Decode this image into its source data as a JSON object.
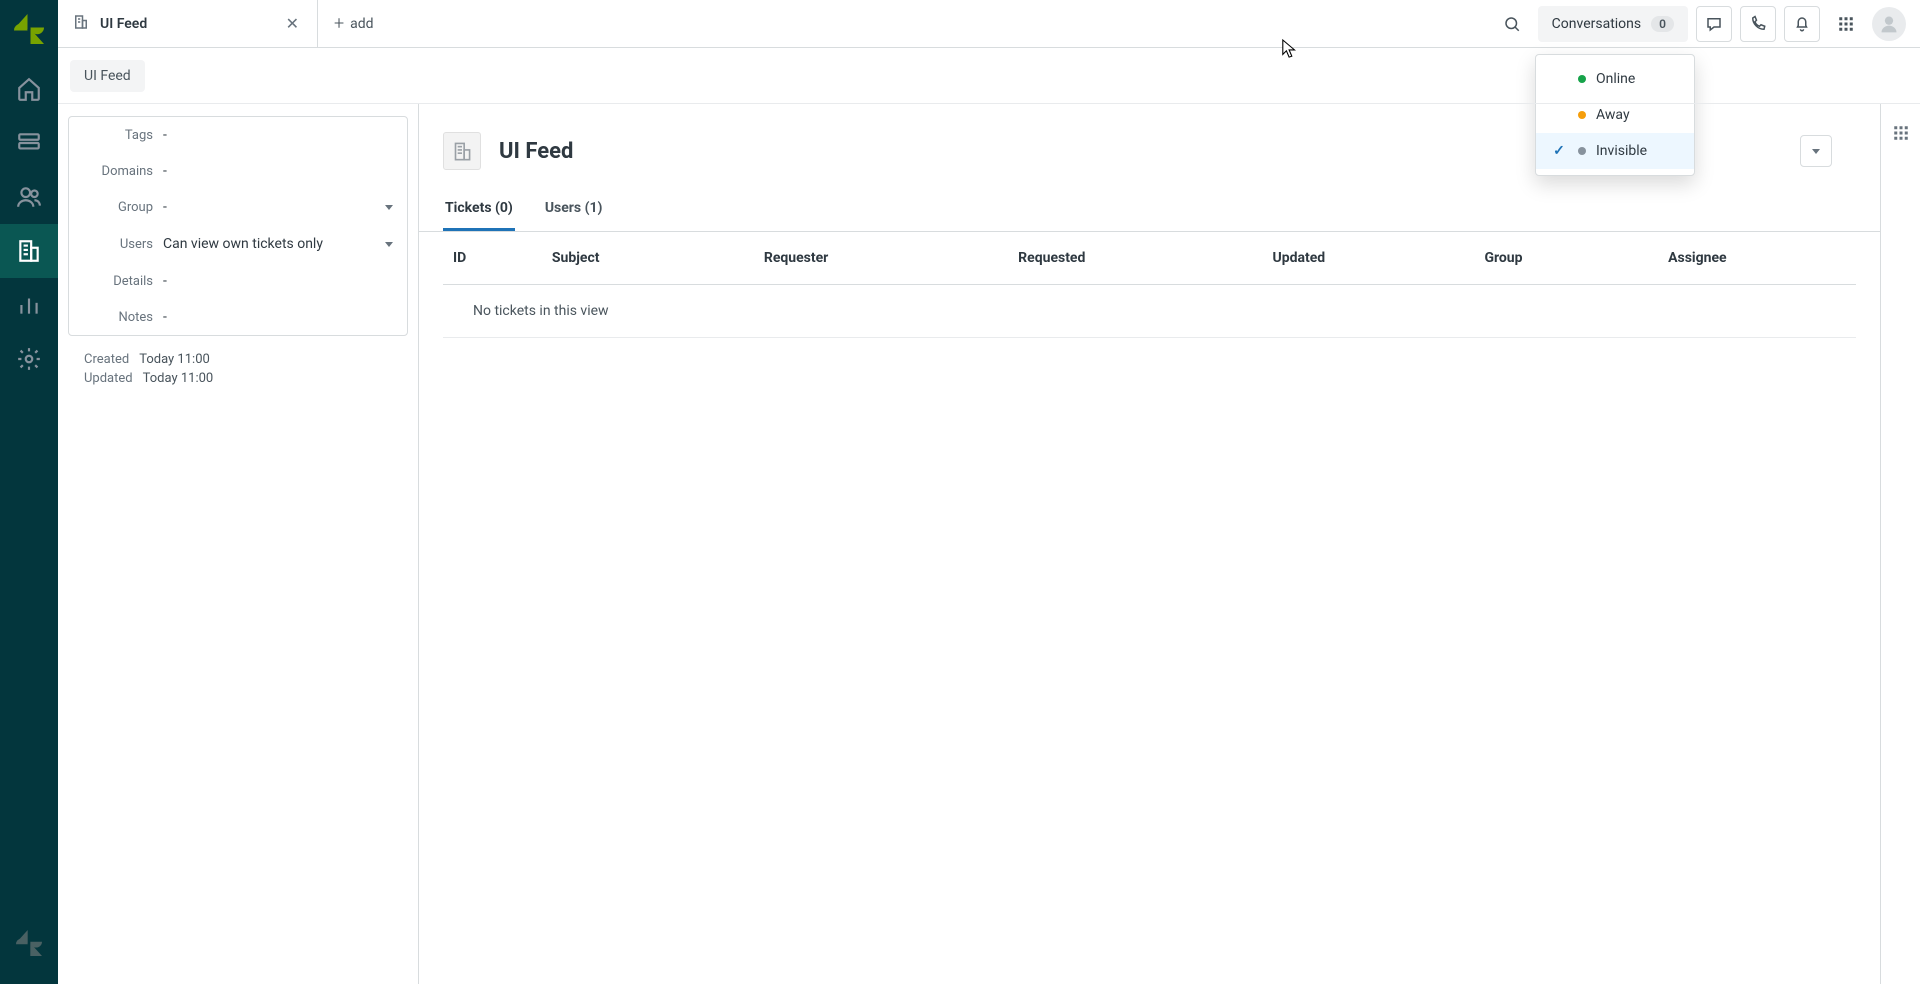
{
  "tab": {
    "title": "UI Feed",
    "add_label": "add"
  },
  "header": {
    "conversations_label": "Conversations",
    "conversations_count": "0"
  },
  "status_menu": {
    "online": "Online",
    "away": "Away",
    "invisible": "Invisible"
  },
  "breadcrumb": {
    "label": "UI Feed"
  },
  "details": {
    "tags_label": "Tags",
    "tags_value": "-",
    "domains_label": "Domains",
    "domains_value": "-",
    "group_label": "Group",
    "group_value": "-",
    "users_label": "Users",
    "users_value": "Can view own tickets only",
    "details_label": "Details",
    "details_value": "-",
    "notes_label": "Notes",
    "notes_value": "-"
  },
  "meta": {
    "created_label": "Created",
    "created_value": "Today 11:00",
    "updated_label": "Updated",
    "updated_value": "Today 11:00"
  },
  "content": {
    "title": "UI Feed",
    "tab_tickets": "Tickets (0)",
    "tab_users": "Users (1)",
    "columns": {
      "id": "ID",
      "subject": "Subject",
      "requester": "Requester",
      "requested": "Requested",
      "updated": "Updated",
      "group": "Group",
      "assignee": "Assignee"
    },
    "empty": "No tickets in this view"
  }
}
